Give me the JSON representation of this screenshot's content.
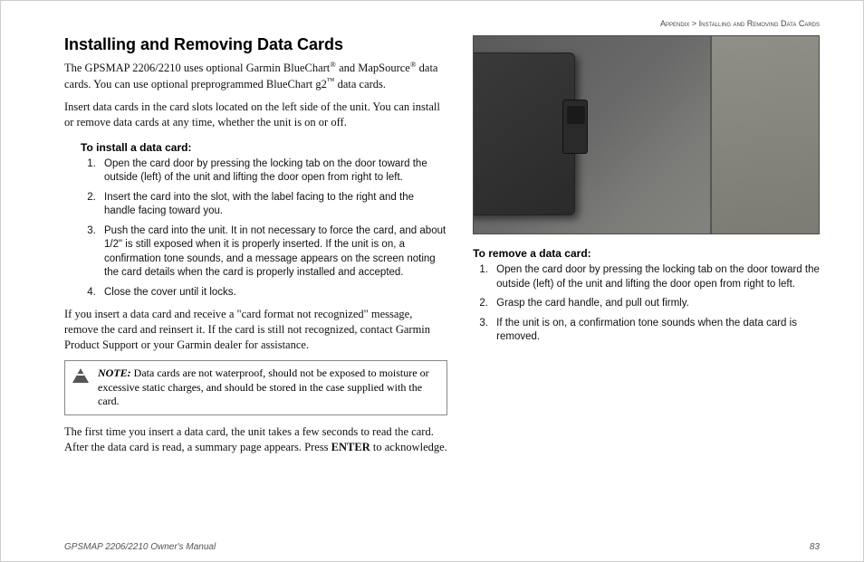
{
  "header": {
    "path_left": "Appendix",
    "path_sep": " > ",
    "path_right": "Installing and Removing Data Cards"
  },
  "h1": "Installing and Removing Data Cards",
  "intro1_a": "The GPSMAP 2206/2210 uses optional Garmin BlueChart",
  "intro1_b": " and MapSource",
  "intro1_c": " data cards. You can use optional preprogrammed BlueChart g2",
  "intro1_d": " data cards.",
  "intro2": "Insert data cards in the card slots located on the left side of the unit. You can install or remove data cards at any time, whether the unit is on or off.",
  "install_h": "To install a data card:",
  "install_steps": [
    "Open the card door by pressing the locking tab on the door toward the outside (left) of the unit and lifting the door open from right to left.",
    "Insert the card into the slot, with the label facing to the right and the handle facing toward you.",
    "Push the card into the unit. It in not necessary to force the card, and about 1/2\" is still exposed when it is properly inserted. If the unit is on, a confirmation tone sounds, and a message appears on the screen noting the card details when the card is properly installed and accepted.",
    "Close the cover until it locks."
  ],
  "not_recognized": "If you insert a data card and receive a \"card format not recognized\" message, remove the card and reinsert it. If the card is still not recognized, contact Garmin Product Support or your Garmin dealer for assistance.",
  "note_label": "NOTE:",
  "note_body": " Data cards are not waterproof, should not be exposed to moisture or excessive static charges, and should be stored in the case supplied with the card.",
  "first_time_a": "The first time you insert a data card, the unit takes a few seconds to read the card. After the data card is read, a summary page appears. Press ",
  "first_time_enter": "ENTER",
  "first_time_b": " to acknowledge.",
  "remove_h": "To remove a data card:",
  "remove_steps": [
    "Open the card door by pressing the locking tab on the door toward the outside (left) of the unit and lifting the door open from right to left.",
    "Grasp the card handle, and pull out firmly.",
    "If the unit is on, a confirmation tone sounds when the data card is removed."
  ],
  "footer": {
    "manual": "GPSMAP 2206/2210 Owner's Manual",
    "page": "83"
  },
  "marks": {
    "reg": "®",
    "tm": "™"
  }
}
